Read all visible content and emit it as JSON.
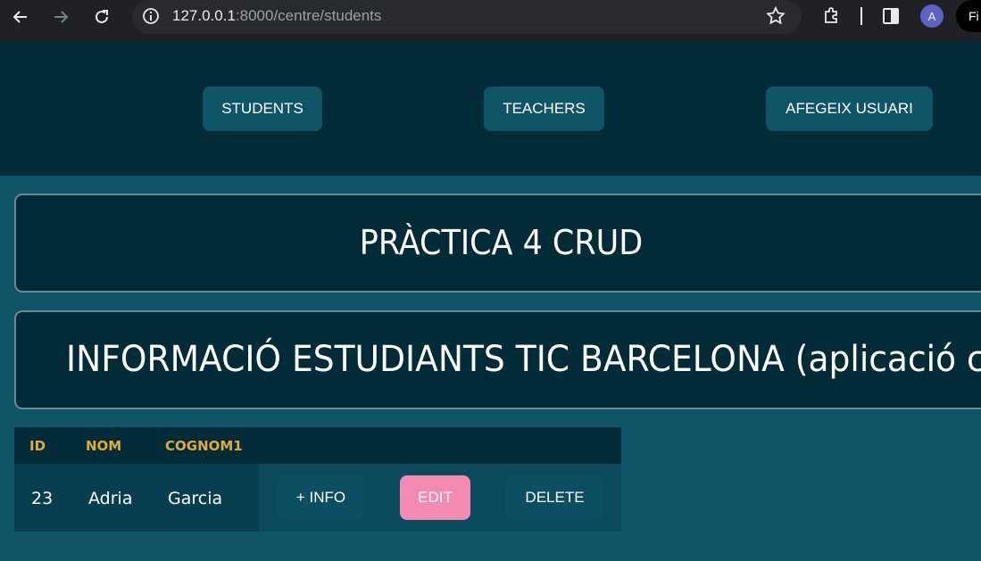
{
  "browser": {
    "url_host": "127.0.0.1",
    "url_rest": ":8000/centre/students",
    "avatar_letter": "A",
    "profile_label": "Fi"
  },
  "nav": {
    "students": "STUDENTS",
    "teachers": "TEACHERS",
    "add_user": "AFEGEIX USUARI"
  },
  "headings": {
    "title": "PRÀCTICA 4 CRUD",
    "subtitle": "INFORMACIÓ ESTUDIANTS TIC BARCELONA (aplicació ce"
  },
  "table": {
    "columns": [
      "ID",
      "NOM",
      "COGNOM1"
    ],
    "rows": [
      {
        "id": "23",
        "nom": "Adria",
        "cognom1": "Garcia",
        "info": "+ INFO",
        "edit": "EDIT",
        "delete": "DELETE"
      }
    ]
  },
  "colors": {
    "page_bg": "#105468",
    "dark_bg": "#022b38",
    "header_text": "#e2a93b",
    "edit_button": "#f28ab2"
  }
}
